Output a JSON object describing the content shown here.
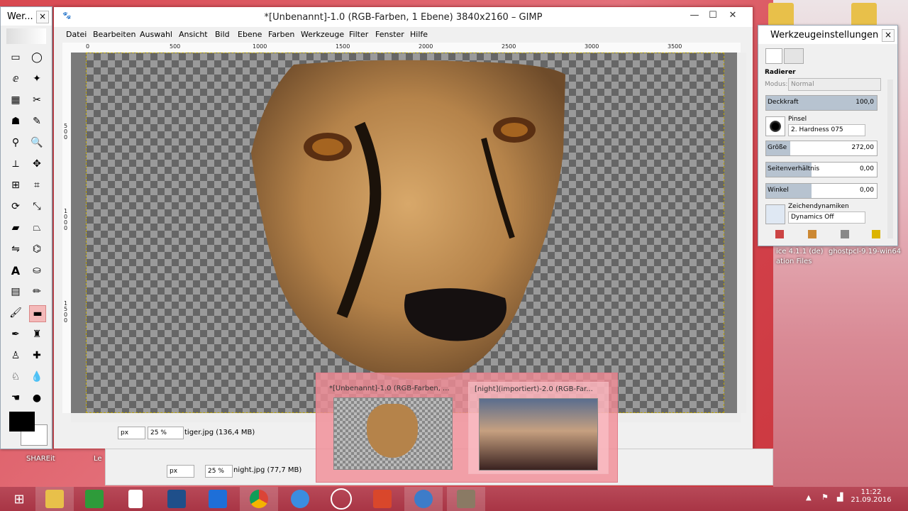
{
  "toolbox": {
    "title": "Wer...",
    "close": "×"
  },
  "main_window": {
    "title": "*[Unbenannt]-1.0 (RGB-Farben, 1 Ebene) 3840x2160 – GIMP",
    "controls": {
      "minimize": "—",
      "maximize": "☐",
      "close": "✕"
    },
    "menus": [
      "Datei",
      "Bearbeiten",
      "Auswahl",
      "Ansicht",
      "Bild",
      "Ebene",
      "Farben",
      "Werkzeuge",
      "Filter",
      "Fenster",
      "Hilfe"
    ],
    "ruler_top": [
      "0",
      "500",
      "1000",
      "1500",
      "2000",
      "2500",
      "3000",
      "3500"
    ],
    "ruler_left": [
      "5\n0\n0",
      "1\n0\n0\n0",
      "1\n5\n0\n0"
    ],
    "status": {
      "unit": "px",
      "zoom": "25 %",
      "file": "tiger.jpg (136,4 MB)"
    }
  },
  "second_window": {
    "status": {
      "unit": "px",
      "zoom": "25 %",
      "file": "night.jpg (77,7 MB)"
    }
  },
  "tool_options": {
    "title": "Werkzeugeinstellungen",
    "tool_name": "Radierer",
    "mode_label": "Modus:",
    "mode_value": "Normal",
    "opacity_label": "Deckkraft",
    "opacity_value": "100,0",
    "brush_label": "Pinsel",
    "brush_value": "2. Hardness 075",
    "size_label": "Größe",
    "size_value": "272,00",
    "aspect_label": "Seitenverhältnis",
    "aspect_value": "0,00",
    "angle_label": "Winkel",
    "angle_value": "0,00",
    "dynamics_label": "Zeichendynamiken",
    "dynamics_value": "Dynamics Off"
  },
  "switcher": {
    "items": [
      {
        "title": "*[Unbenannt]-1.0 (RGB-Farben, ..."
      },
      {
        "title": "[night](importiert)-2.0 (RGB-Far..."
      }
    ]
  },
  "desktop": {
    "icons": [
      "SHAREit",
      "Le",
      "ice 4.1.1 (de)",
      "ghostpcl-9.19-win64",
      "ation Files"
    ]
  },
  "clock": {
    "time": "11:22",
    "date": "21.09.2016"
  },
  "colors": {
    "taskbar": "#a83545",
    "desktop": "#d84850",
    "active_tool": "#f4b9b9"
  }
}
